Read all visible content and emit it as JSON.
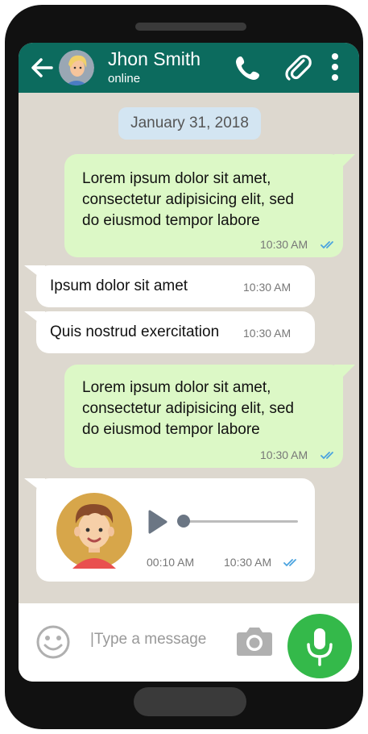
{
  "header": {
    "contact_name": "Jhon Smith",
    "status": "online",
    "back_icon": "arrow-left-icon",
    "call_icon": "phone-icon",
    "attach_icon": "paperclip-icon",
    "menu_icon": "more-vertical-icon"
  },
  "chat": {
    "date_separator": "January 31, 2018",
    "messages": [
      {
        "direction": "outgoing",
        "lines": [
          "Lorem ipsum dolor sit amet,",
          "consectetur adipisicing elit, sed",
          "do eiusmod tempor labore"
        ],
        "time": "10:30 AM",
        "status": "read"
      },
      {
        "direction": "incoming",
        "text": "Ipsum dolor sit amet",
        "time": "10:30 AM"
      },
      {
        "direction": "incoming",
        "text": "Quis nostrud exercitation",
        "time": "10:30 AM"
      },
      {
        "direction": "outgoing",
        "lines": [
          "Lorem ipsum dolor sit amet,",
          "consectetur adipisicing elit, sed",
          "do eiusmod tempor labore"
        ],
        "time": "10:30 AM",
        "status": "read"
      }
    ],
    "voice_message": {
      "duration": "00:10 AM",
      "time": "10:30 AM",
      "status": "read",
      "progress": 0.0
    }
  },
  "composer": {
    "placeholder": "|Type a message",
    "emoji_icon": "smiley-icon",
    "camera_icon": "camera-icon",
    "mic_icon": "microphone-icon"
  },
  "colors": {
    "header": "#0c6b5e",
    "outgoing_bubble": "#dcf8c6",
    "incoming_bubble": "#ffffff",
    "chat_background": "#ddd8cf",
    "read_tick": "#4aa3df",
    "mic_button": "#34b94a"
  }
}
